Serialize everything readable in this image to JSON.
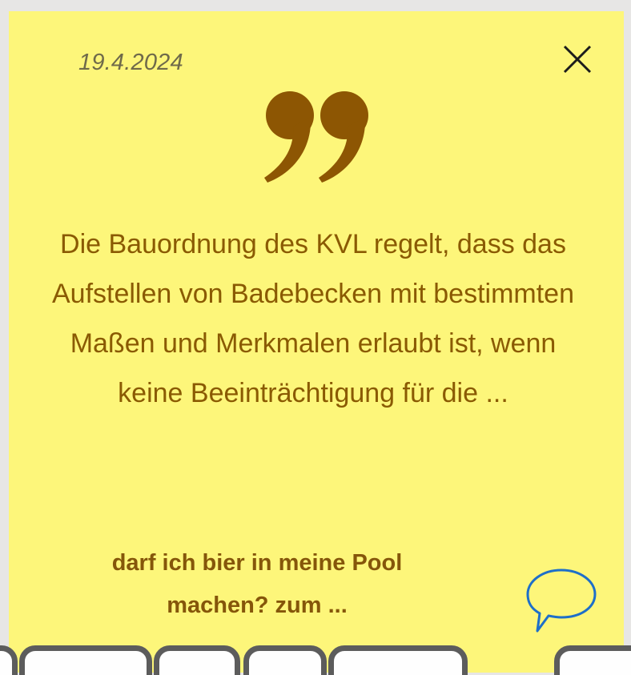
{
  "note": {
    "date": "19.4.2024",
    "quote_text": "Die Bauordnung des KVL regelt, dass das Aufstellen von Badebecken mit bestimmten Maßen und Merkmalen erlaubt ist, wenn keine Beeinträchtigung für die ...",
    "question_text": "darf ich bier in meine Pool machen? zum ...",
    "colors": {
      "background": "#fdf67a",
      "text": "#8a5a02",
      "quote_mark": "#8d5603",
      "comment_icon": "#1e6fc9"
    },
    "icons": {
      "close": "close-icon",
      "quote": "quote-icon",
      "comment": "speech-bubble-icon"
    }
  }
}
